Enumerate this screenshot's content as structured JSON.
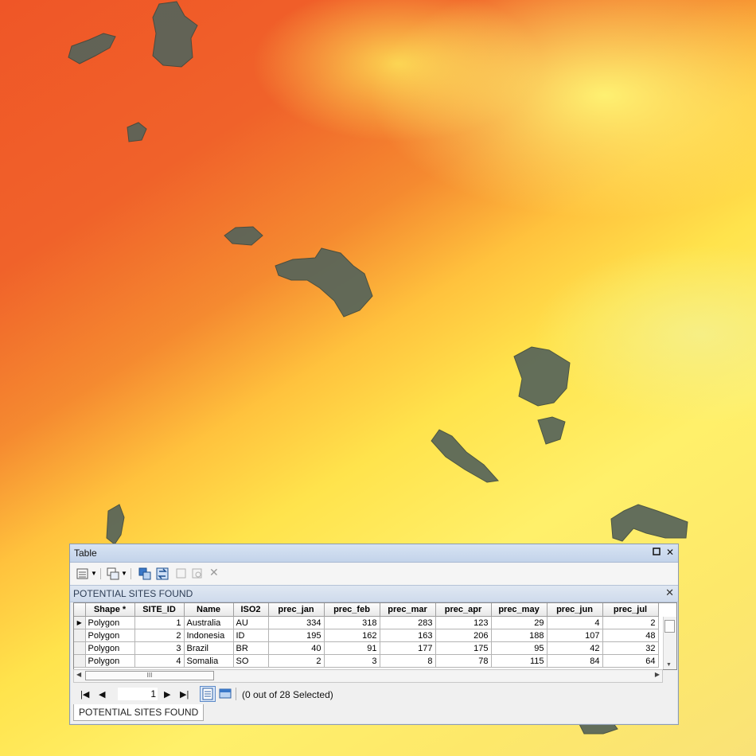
{
  "window": {
    "title": "Table"
  },
  "table_header": {
    "label": "POTENTIAL SITES FOUND"
  },
  "columns": [
    "Shape *",
    "SITE_ID",
    "Name",
    "ISO2",
    "prec_jan",
    "prec_feb",
    "prec_mar",
    "prec_apr",
    "prec_may",
    "prec_jun",
    "prec_jul"
  ],
  "rows": [
    [
      "Polygon",
      "1",
      "Australia",
      "AU",
      "334",
      "318",
      "283",
      "123",
      "29",
      "4",
      "2"
    ],
    [
      "Polygon",
      "2",
      "Indonesia",
      "ID",
      "195",
      "162",
      "163",
      "206",
      "188",
      "107",
      "48"
    ],
    [
      "Polygon",
      "3",
      "Brazil",
      "BR",
      "40",
      "91",
      "177",
      "175",
      "95",
      "42",
      "32"
    ],
    [
      "Polygon",
      "4",
      "Somalia",
      "SO",
      "2",
      "3",
      "8",
      "78",
      "115",
      "84",
      "64"
    ]
  ],
  "navigation": {
    "current_record": "1",
    "selection_status": "(0 out of 28 Selected)"
  },
  "bottom_tab": {
    "label": "POTENTIAL SITES FOUND"
  },
  "scrollbar": {
    "thumb_grip": "III"
  },
  "map": {
    "palette": [
      "#ef4a22",
      "#f58a30",
      "#ffd23f",
      "#fff06a",
      "#56645a"
    ],
    "polygon_color": "#56645a"
  }
}
